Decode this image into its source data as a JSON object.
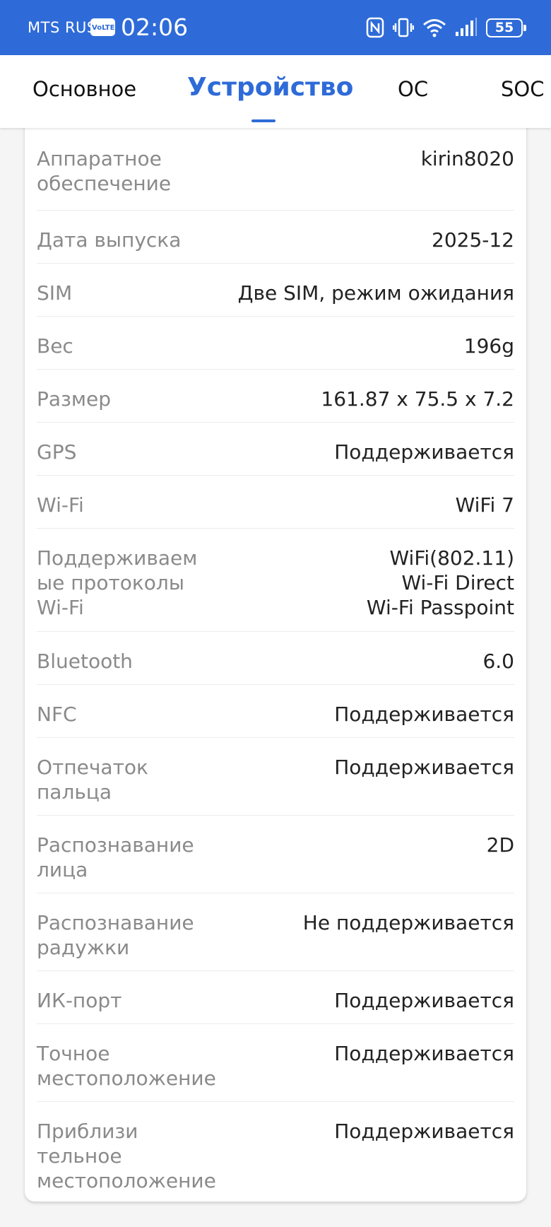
{
  "status_bar": {
    "carrier": "MTS RUS",
    "volte": "VoLTE",
    "time": "02:06",
    "battery": "55",
    "icons": [
      "nfc-icon",
      "vibrate-icon",
      "wifi-icon",
      "signal-icon",
      "battery-icon"
    ]
  },
  "tabs": [
    {
      "label": "Основное",
      "active": false
    },
    {
      "label": "Устройство",
      "active": true
    },
    {
      "label": "ОС",
      "active": false
    },
    {
      "label": "SOC",
      "active": false
    }
  ],
  "colors": {
    "accent": "#2e6bd8",
    "label": "#8a8a8a",
    "value": "#222222",
    "background": "#f5f5f5"
  },
  "specs": [
    {
      "label": "Аппаратное\nобеспечение",
      "value": "kirin8020"
    },
    {
      "label": "Дата выпуска",
      "value": "2025-12"
    },
    {
      "label": "SIM",
      "value": "Две SIM, режим ожидания"
    },
    {
      "label": "Вес",
      "value": "196g"
    },
    {
      "label": "Размер",
      "value": "161.87 x 75.5 x 7.2"
    },
    {
      "label": "GPS",
      "value": "Поддерживается"
    },
    {
      "label": "Wi-Fi",
      "value": "WiFi 7"
    },
    {
      "label": "Поддерживаем\nые протоколы\nWi-Fi",
      "value": "WiFi(802.11)\nWi-Fi Direct\nWi-Fi Passpoint"
    },
    {
      "label": "Bluetooth",
      "value": "6.0"
    },
    {
      "label": "NFC",
      "value": "Поддерживается"
    },
    {
      "label": "Отпечаток\nпальца",
      "value": "Поддерживается"
    },
    {
      "label": "Распознавание\nлица",
      "value": "2D"
    },
    {
      "label": "Распознавание\nрадужки",
      "value": "Не поддерживается"
    },
    {
      "label": "ИК-порт",
      "value": "Поддерживается"
    },
    {
      "label": "Точное\nместоположение",
      "value": "Поддерживается"
    },
    {
      "label": "Приблизи\nтельное\nместоположение",
      "value": "Поддерживается"
    }
  ]
}
